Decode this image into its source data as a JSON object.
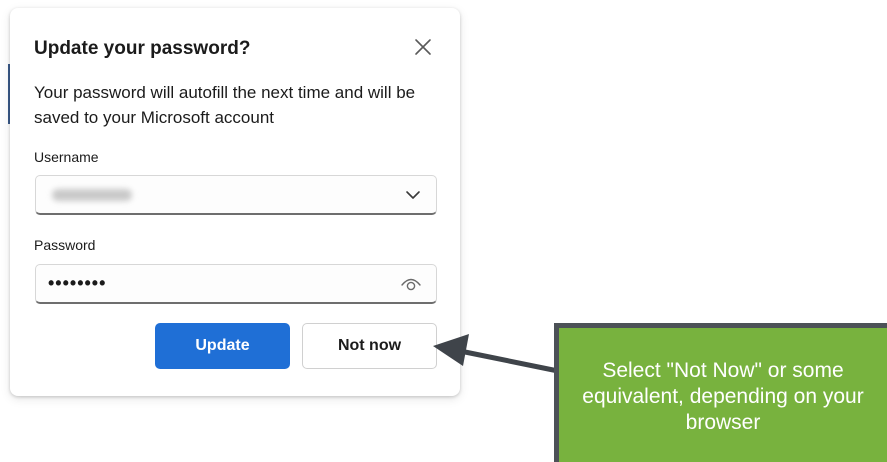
{
  "dialog": {
    "title": "Update your password?",
    "description": "Your password will autofill the next time and will be saved to your Microsoft account",
    "username": {
      "label": "Username",
      "value": ""
    },
    "password": {
      "label": "Password",
      "value": "••••••••"
    },
    "buttons": {
      "update": "Update",
      "not_now": "Not now"
    }
  },
  "callout": {
    "text": "Select \"Not Now\" or some equivalent, depending on your browser"
  },
  "icons": {
    "close": "close-icon",
    "dropdown": "chevron-down-icon",
    "reveal": "eye-icon"
  },
  "colors": {
    "primary_button": "#1f6fd6",
    "callout_fill": "#78b23e",
    "callout_border": "#4c5157",
    "arrow": "#3f444a"
  }
}
